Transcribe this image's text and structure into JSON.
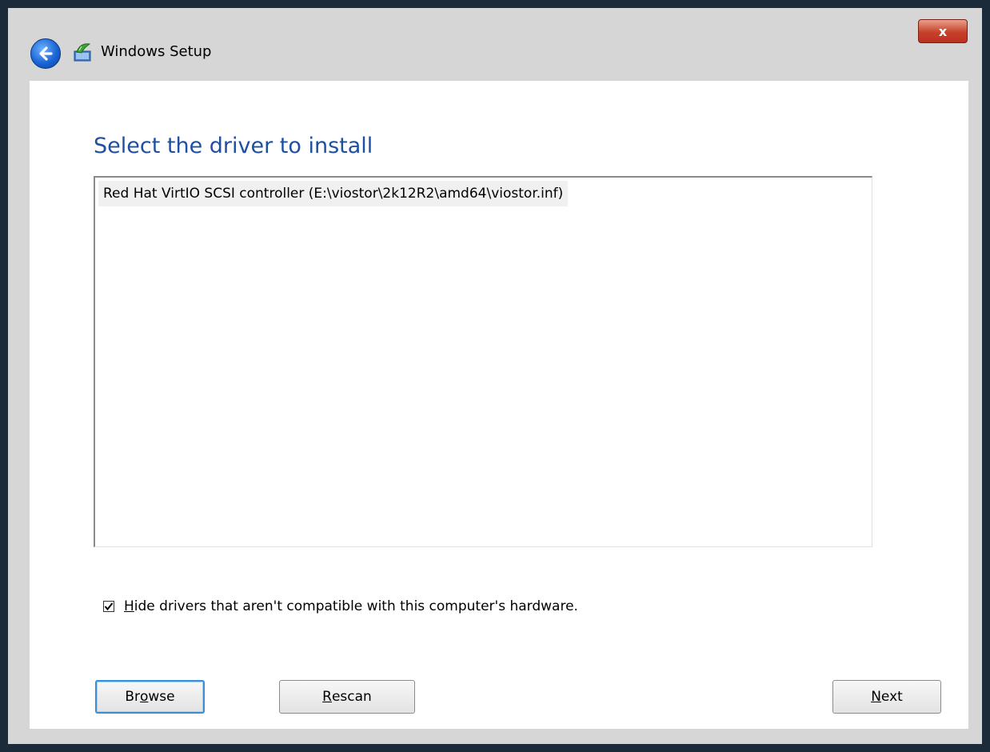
{
  "window": {
    "title": "Windows Setup",
    "close_glyph": "x",
    "icons": {
      "back": "back-arrow-icon",
      "app": "windows-setup-icon",
      "close": "close-icon"
    }
  },
  "page": {
    "heading": "Select the driver to install"
  },
  "driver_list": {
    "items": [
      {
        "label": "Red Hat VirtIO SCSI controller (E:\\viostor\\2k12R2\\amd64\\viostor.inf)"
      }
    ]
  },
  "options": {
    "hide_incompatible": {
      "checked": true,
      "label_access_key": "H",
      "label_rest": "ide drivers that aren't compatible with this computer's hardware."
    }
  },
  "buttons": {
    "browse": {
      "pre": "Br",
      "key": "o",
      "post": "wse"
    },
    "rescan": {
      "pre": "",
      "key": "R",
      "post": "escan"
    },
    "next": {
      "pre": "",
      "key": "N",
      "post": "ext"
    }
  },
  "colors": {
    "heading": "#1e4fa3",
    "close_button": "#c7412a",
    "back_button": "#1a66d6",
    "selection": "#f0f0f0"
  }
}
